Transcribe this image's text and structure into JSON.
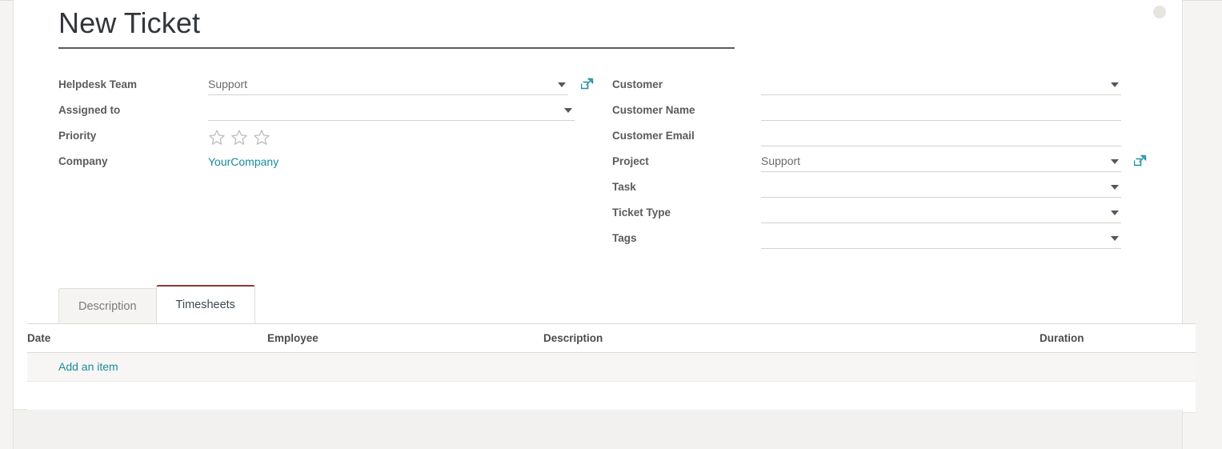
{
  "page": {
    "title": "New Ticket",
    "accent_teal": "#1a8a9d",
    "active_tab_border": "#8b3a32",
    "background": "#f5f4f2",
    "sheet_background": "#ffffff"
  },
  "form": {
    "left_fields": [
      {
        "label": "Helpdesk Team",
        "value": "Support",
        "has_caret": true,
        "has_ext_link": true,
        "type": "dropdown"
      },
      {
        "label": "Assigned to",
        "value": "",
        "has_caret": true,
        "has_ext_link": false,
        "type": "dropdown"
      },
      {
        "label": "Priority",
        "value": "",
        "has_caret": false,
        "has_ext_link": false,
        "type": "stars",
        "stars_total": 3,
        "stars_filled": 0
      },
      {
        "label": "Company",
        "value": "YourCompany",
        "has_caret": false,
        "has_ext_link": false,
        "type": "link"
      }
    ],
    "right_fields": [
      {
        "label": "Customer",
        "value": "",
        "has_caret": true,
        "has_ext_link": false,
        "type": "dropdown"
      },
      {
        "label": "Customer Name",
        "value": "",
        "has_caret": false,
        "has_ext_link": false,
        "type": "text"
      },
      {
        "label": "Customer Email",
        "value": "",
        "has_caret": false,
        "has_ext_link": false,
        "type": "text"
      },
      {
        "label": "Project",
        "value": "Support",
        "has_caret": true,
        "has_ext_link": true,
        "type": "dropdown"
      },
      {
        "label": "Task",
        "value": "",
        "has_caret": true,
        "has_ext_link": false,
        "type": "dropdown"
      },
      {
        "label": "Ticket Type",
        "value": "",
        "has_caret": true,
        "has_ext_link": false,
        "type": "dropdown"
      },
      {
        "label": "Tags",
        "value": "",
        "has_caret": true,
        "has_ext_link": false,
        "type": "dropdown"
      }
    ]
  },
  "notebook": {
    "tabs": [
      {
        "label": "Description",
        "active": false
      },
      {
        "label": "Timesheets",
        "active": true
      }
    ]
  },
  "timesheets": {
    "columns": [
      "Date",
      "Employee",
      "Description",
      "Duration"
    ],
    "rows": [],
    "add_item_label": "Add an item"
  },
  "icons": {
    "external_link": "external-link-icon",
    "dropdown_caret": "chevron-down-icon",
    "star_empty": "star-outline-icon",
    "avatar": "avatar-placeholder-icon"
  }
}
